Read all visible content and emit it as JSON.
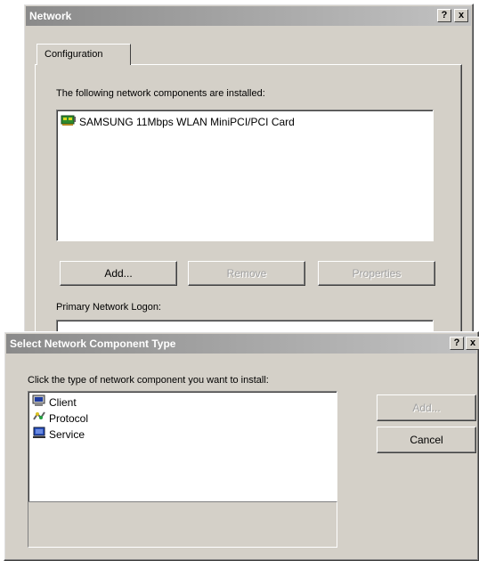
{
  "network_dialog": {
    "title": "Network",
    "help_button": "?",
    "close_button": "x",
    "tab_label": "Configuration",
    "installed_label": "The following network components are installed:",
    "components": [
      {
        "label": "SAMSUNG 11Mbps WLAN MiniPCI/PCI Card",
        "icon": "network-card-icon"
      }
    ],
    "add_button": "Add...",
    "remove_button": "Remove",
    "properties_button": "Properties",
    "logon_label": "Primary Network Logon:"
  },
  "select_dialog": {
    "title": "Select Network Component Type",
    "help_button": "?",
    "close_button": "x",
    "instruction": "Click the type of network component you want to install:",
    "types": [
      {
        "label": "Client",
        "icon": "client-icon"
      },
      {
        "label": "Protocol",
        "icon": "protocol-icon"
      },
      {
        "label": "Service",
        "icon": "service-icon"
      }
    ],
    "add_button": "Add...",
    "cancel_button": "Cancel"
  }
}
